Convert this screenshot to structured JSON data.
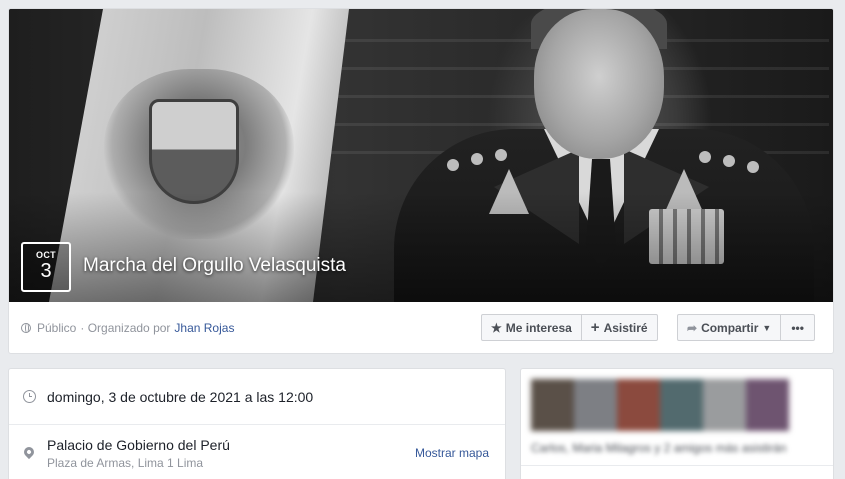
{
  "event": {
    "month": "OCT",
    "day": "3",
    "title": "Marcha del Orgullo Velasquista",
    "privacy": "Público",
    "organized_by_prefix": "· Organizado por",
    "organizer": "Jhan Rojas"
  },
  "actions": {
    "interested": "Me interesa",
    "going": "Asistiré",
    "share": "Compartir",
    "more": "•••"
  },
  "details": {
    "date_time": "domingo, 3 de octubre de 2021 a las 12:00",
    "place_name": "Palacio de Gobierno del Perú",
    "place_address": "Plaza de Armas, Lima 1 Lima",
    "map_link": "Mostrar mapa"
  },
  "attendees": {
    "summary": "Carlos, Maria Milagros y 2 amigos más asistirán"
  },
  "colors": {
    "link": "#365899",
    "muted": "#90949c",
    "background": "#e9ebee"
  }
}
